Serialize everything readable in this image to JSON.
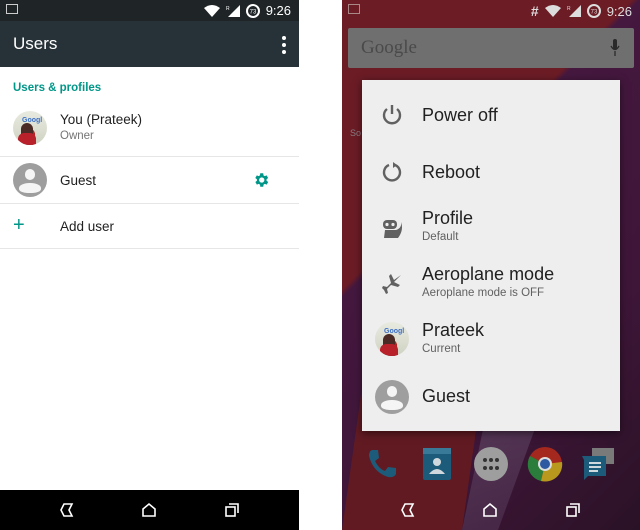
{
  "left_screen": {
    "status_bar": {
      "time": "9:26",
      "icons": [
        "image-notification-icon",
        "wifi-icon",
        "signal-roaming-icon",
        "battery-icon"
      ],
      "battery_badge": "73"
    },
    "app_bar": {
      "title": "Users",
      "menu_icon": "overflow-menu-icon"
    },
    "section_header": "Users & profiles",
    "users": [
      {
        "name": "You (Prateek)",
        "role": "Owner",
        "avatar": "photo"
      },
      {
        "name": "Guest",
        "role": "",
        "avatar": "default-person",
        "action_icon": "gear-icon"
      }
    ],
    "add_user": {
      "label": "Add user",
      "icon": "plus-icon"
    },
    "nav_bar": [
      "back-icon",
      "home-icon",
      "recents-icon"
    ]
  },
  "right_screen": {
    "status_bar": {
      "time": "9:26",
      "icons": [
        "image-notification-icon",
        "hash-icon",
        "wifi-icon",
        "signal-roaming-icon",
        "battery-icon"
      ],
      "battery_badge": "73"
    },
    "search_bar": {
      "placeholder": "Google",
      "icon": "mic-icon"
    },
    "side_text": "So",
    "power_menu": [
      {
        "title": "Power off",
        "subtitle": "",
        "icon": "power-icon"
      },
      {
        "title": "Reboot",
        "subtitle": "",
        "icon": "reboot-icon"
      },
      {
        "title": "Profile",
        "subtitle": "Default",
        "icon": "cyanogen-mascot-icon"
      },
      {
        "title": "Aeroplane mode",
        "subtitle": "Aeroplane mode is OFF",
        "icon": "airplane-icon"
      },
      {
        "title": "Prateek",
        "subtitle": "Current",
        "icon": "user-photo-avatar"
      },
      {
        "title": "Guest",
        "subtitle": "",
        "icon": "guest-avatar"
      }
    ],
    "dock": [
      "phone-icon",
      "contacts-icon",
      "app-drawer-icon",
      "chrome-icon",
      "messaging-icon"
    ],
    "nav_bar": [
      "back-icon",
      "home-icon",
      "recents-icon"
    ],
    "colors": {
      "wallpaper_red": "#6b1c25",
      "wallpaper_purple": "#3e1638",
      "dialog_bg": "#eeeeee"
    }
  },
  "colors": {
    "accent": "#009688",
    "app_bar": "#263238",
    "status_bar": "#1f2426"
  }
}
